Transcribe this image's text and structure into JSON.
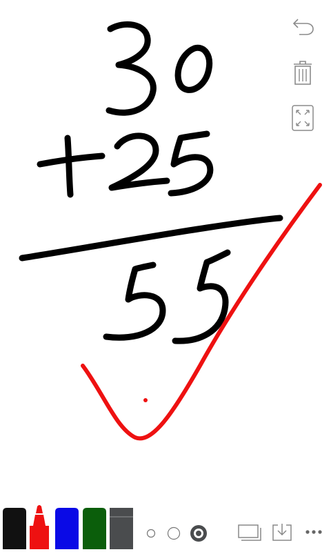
{
  "canvas": {
    "background": "#ffffff",
    "ink_black": "#000000",
    "ink_red": "#ee1111"
  },
  "side_toolbar": [
    {
      "name": "undo-icon",
      "icon": "undo"
    },
    {
      "name": "trash-icon",
      "icon": "trash"
    },
    {
      "name": "fullscreen-icon",
      "icon": "expand"
    }
  ],
  "pens": [
    {
      "name": "pen-black",
      "color": "#111111",
      "kind": "marker",
      "selected": false
    },
    {
      "name": "pen-red",
      "color": "#ee1111",
      "kind": "brush",
      "selected": true
    },
    {
      "name": "pen-blue",
      "color": "#0a0ae6",
      "kind": "marker",
      "selected": false
    },
    {
      "name": "pen-green",
      "color": "#0b5e0b",
      "kind": "marker",
      "selected": false
    },
    {
      "name": "pen-gray",
      "color": "#4a4c4e",
      "kind": "eraser",
      "selected": false
    }
  ],
  "stroke_sizes": [
    {
      "name": "stroke-size-small",
      "selected": false
    },
    {
      "name": "stroke-size-medium",
      "selected": false
    },
    {
      "name": "stroke-size-large",
      "selected": true
    }
  ],
  "bottom_actions": [
    {
      "name": "pages-icon",
      "icon": "pages"
    },
    {
      "name": "download-icon",
      "icon": "download"
    },
    {
      "name": "more-icon",
      "icon": "more"
    }
  ]
}
